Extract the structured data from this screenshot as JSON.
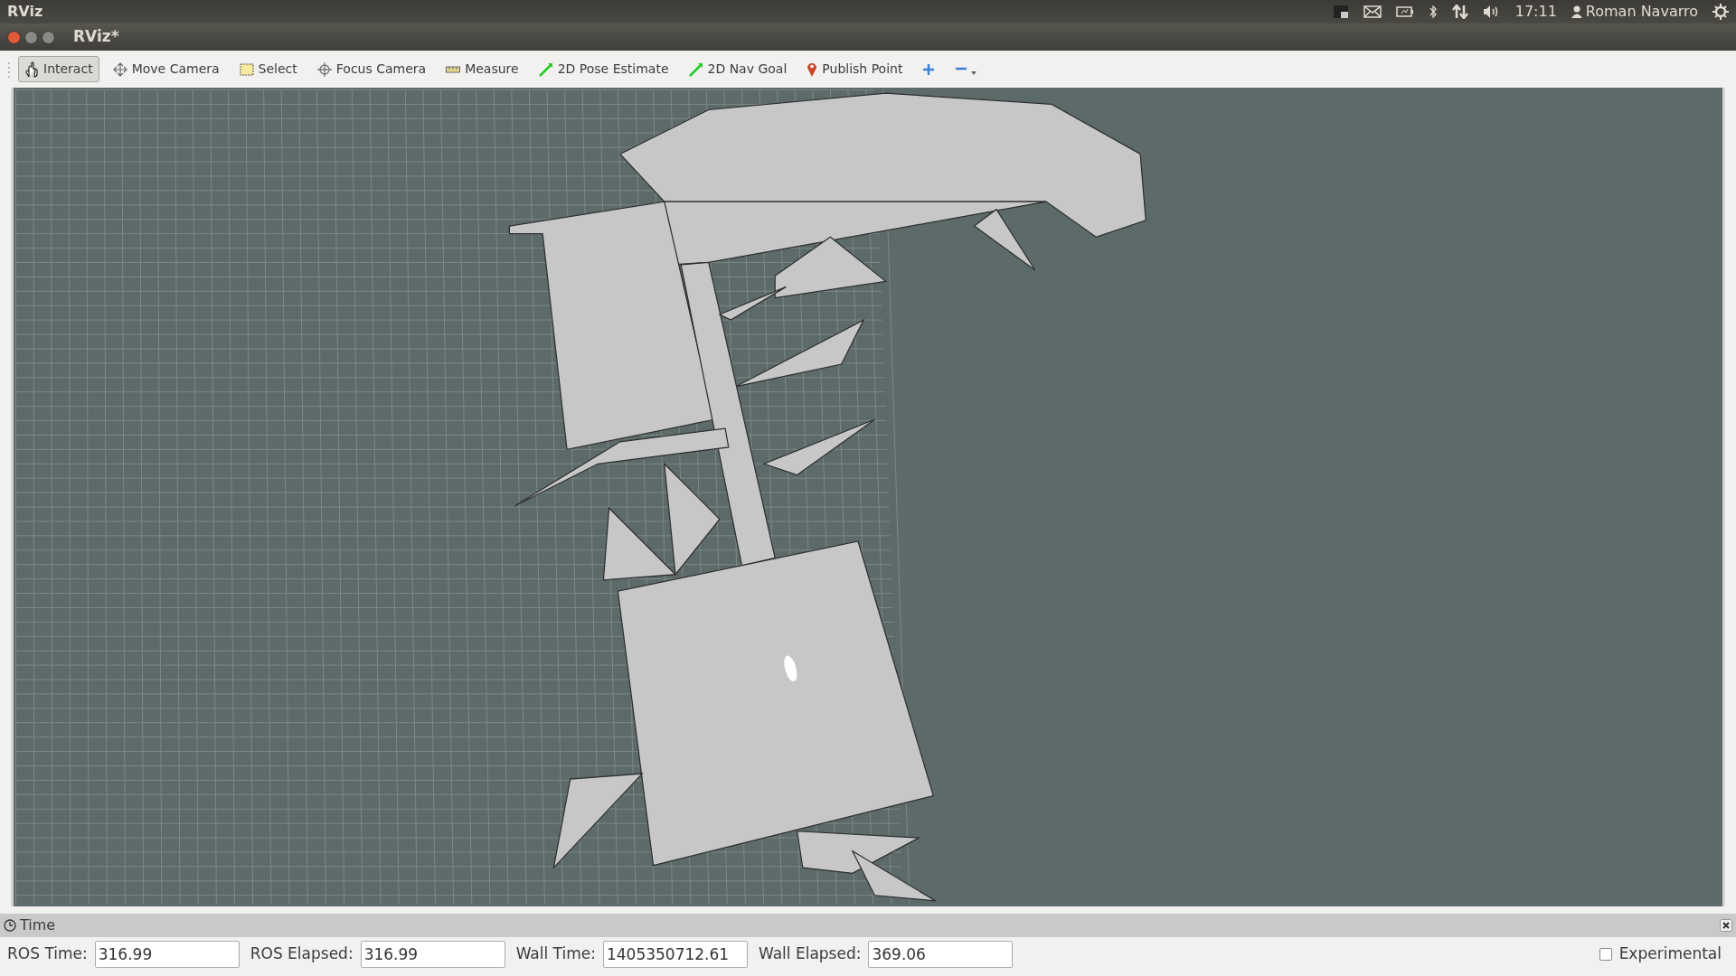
{
  "top_panel": {
    "app_name": "RViz",
    "clock": "17:11",
    "user": "Roman Navarro"
  },
  "window": {
    "title": "RViz*"
  },
  "toolbar": [
    {
      "label": "Interact",
      "selected": true
    },
    {
      "label": "Move Camera",
      "selected": false
    },
    {
      "label": "Select",
      "selected": false
    },
    {
      "label": "Focus Camera",
      "selected": false
    },
    {
      "label": "Measure",
      "selected": false
    },
    {
      "label": "2D Pose Estimate",
      "selected": false
    },
    {
      "label": "2D Nav Goal",
      "selected": false
    },
    {
      "label": "Publish Point",
      "selected": false
    }
  ],
  "time_panel": {
    "title": "Time",
    "fields": [
      {
        "label": "ROS Time:",
        "value": "316.99"
      },
      {
        "label": "ROS Elapsed:",
        "value": "316.99"
      },
      {
        "label": "Wall Time:",
        "value": "1405350712.61"
      },
      {
        "label": "Wall Elapsed:",
        "value": "369.06"
      }
    ],
    "experimental": {
      "label": "Experimental",
      "checked": false
    }
  }
}
